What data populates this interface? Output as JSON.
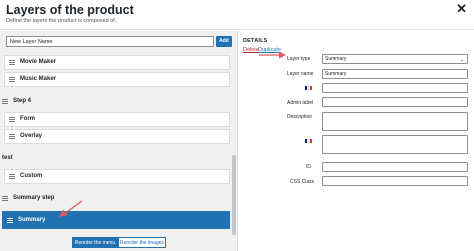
{
  "header": {
    "title": "Layers of the product",
    "subtitle": "Define the layers the product is composed of.",
    "close_icon": "close-icon"
  },
  "left_panel": {
    "new_layer_value": "New Layer Name",
    "add_label": "Add",
    "layers": [
      {
        "label": "Movie Maker",
        "level": "child",
        "selected": false
      },
      {
        "label": "Music Maker",
        "level": "child",
        "selected": false
      },
      {
        "label": "Step 4",
        "level": "top",
        "selected": false
      },
      {
        "label": "Form",
        "level": "child",
        "selected": false
      },
      {
        "label": "Overlay",
        "level": "child",
        "selected": false
      },
      {
        "label": "test",
        "level": "top",
        "selected": false
      },
      {
        "label": "Custom",
        "level": "child",
        "selected": false
      },
      {
        "label": "Summary step",
        "level": "top",
        "selected": false
      },
      {
        "label": "Summary",
        "level": "child",
        "selected": true
      }
    ],
    "tabs": [
      "Reorder the menu",
      "Reorder the images"
    ],
    "active_tab": "Reorder the menu"
  },
  "right_panel": {
    "heading": "DETAILS",
    "delete_label": "Delete",
    "duplicate_label": "Duplicate",
    "fields": {
      "layer_type_label": "Layer type",
      "layer_type_value": "Summary",
      "layer_name_label": "Layer name",
      "layer_name_value": "Summary",
      "admin_label_label": "Admin label",
      "description_label": "Description",
      "id_label": "ID",
      "css_class_label": "CSS Class"
    },
    "flag_icon": "french-flag-icon"
  },
  "annotations": {
    "arrow_color": "#e05a5a",
    "accent_color": "#2271b1",
    "delete_color": "#b32d2e"
  }
}
